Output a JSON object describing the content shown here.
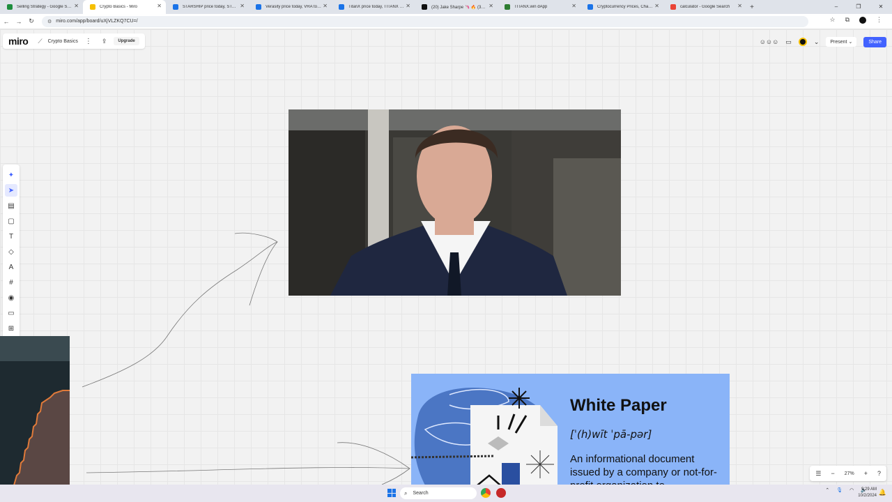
{
  "browser": {
    "tabs": [
      {
        "title": "Selling Strategy - Google Shee",
        "color": "#1e8e3e",
        "active": false
      },
      {
        "title": "Crypto Basics - Miro",
        "color": "#f6c000",
        "active": true
      },
      {
        "title": "STARSHIP price today, STARSH",
        "color": "#1a73e8",
        "active": false
      },
      {
        "title": "Verasity price today, VRA to US",
        "color": "#1a73e8",
        "active": false
      },
      {
        "title": "TitanX price today, TITANX to U",
        "color": "#1a73e8",
        "active": false
      },
      {
        "title": "(20) Jake Sharpe 🦄 🔥 (369, 2",
        "color": "#111111",
        "active": false
      },
      {
        "title": "TITANX.win dApp",
        "color": "#2e7d32",
        "active": false
      },
      {
        "title": "Cryptocurrency Prices, Charts A",
        "color": "#1a73e8",
        "active": false
      },
      {
        "title": "calculator - Google Search",
        "color": "#ea4335",
        "active": false
      }
    ],
    "url": "miro.com/app/board/uXjVLZKQ7CU=/",
    "new_tab_label": "+",
    "window_controls": [
      "–",
      "❐",
      "✕"
    ]
  },
  "miro": {
    "logo": "miro",
    "board_name": "Crypto Basics",
    "upgrade_label": "Upgrade",
    "present_label": "Present",
    "share_label": "Share",
    "zoom_level": "27%"
  },
  "white_paper": {
    "title": "White Paper",
    "pronunciation": "[ˈ(h)wīt ˈpā-pər]",
    "definition": "An informational document issued by a company or not-for-profit organization to"
  },
  "taskbar": {
    "search_placeholder": "Search",
    "time": "9:29 AM",
    "date": "10/2/2024"
  },
  "colors": {
    "accent": "#4262ff",
    "white_paper_bg": "#8ab4f8",
    "canvas_bg": "#f2f2f2"
  }
}
